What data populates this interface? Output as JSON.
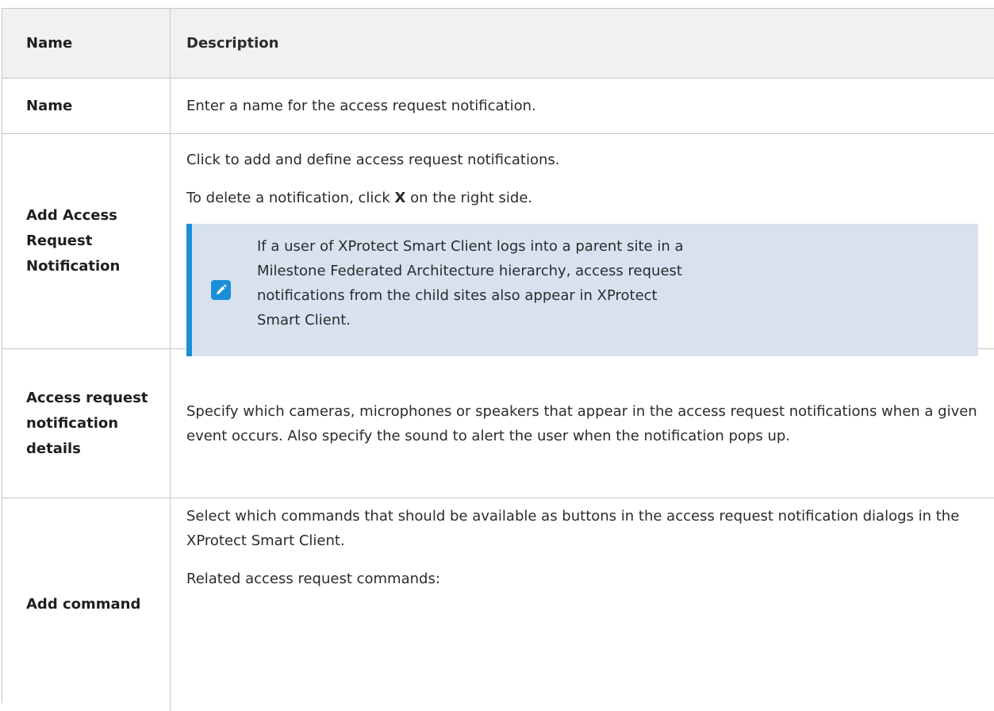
{
  "header": {
    "name": "Name",
    "description": "Description"
  },
  "rows": [
    {
      "name": "Name",
      "description": [
        "Enter a name for the access request notification."
      ]
    },
    {
      "name": "Add Access Request Notification",
      "description": [
        "Click to add and define access request notifications.",
        "To delete a notification, click",
        "X",
        "on the right side."
      ],
      "note": {
        "icon": "pencil-icon",
        "text": "If a user of XProtect Smart Client logs into a parent site in a Milestone Federated Architecture hierarchy, access request notifications from the child sites also appear in XProtect Smart Client."
      }
    },
    {
      "name": "Access request notification details",
      "description": [
        "Specify which cameras, microphones or speakers that appear in the access request notifications when a given event occurs. Also specify the sound to alert the user when the notification pops up."
      ]
    },
    {
      "name": "Add command",
      "description": [
        "Select which commands that should be available as buttons in the access request notification dialogs in the XProtect Smart Client.",
        "Related access request commands:"
      ]
    }
  ],
  "colors": {
    "note_background": "#d8e2ef",
    "note_accent": "#1a8fd8",
    "header_background": "#f1f1f1",
    "border": "#c6c6c6"
  }
}
